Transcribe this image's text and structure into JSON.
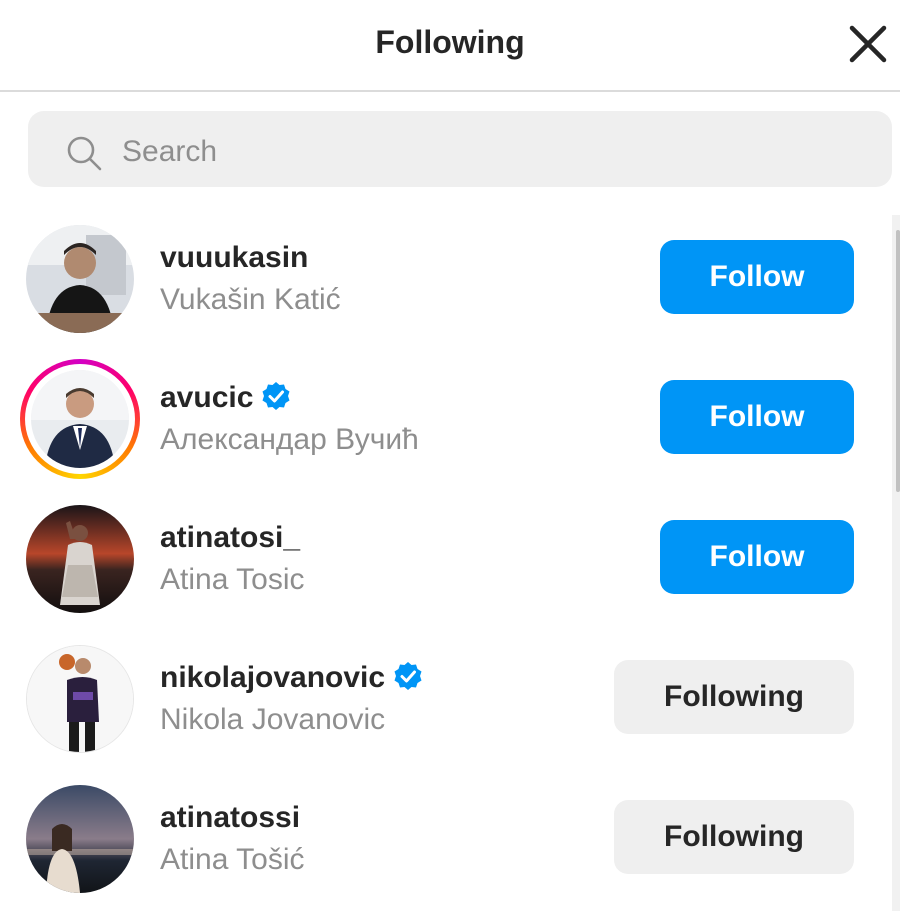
{
  "header": {
    "title": "Following",
    "close_icon": "close-icon"
  },
  "search": {
    "placeholder": "Search",
    "value": "",
    "icon": "search-icon"
  },
  "users": [
    {
      "username": "vuuukasin",
      "full_name": "Vukašin Katić",
      "verified": false,
      "story_ring": false,
      "button": "Follow",
      "button_state": "follow"
    },
    {
      "username": "avucic",
      "full_name": "Александар Вучић",
      "verified": true,
      "story_ring": true,
      "button": "Follow",
      "button_state": "follow"
    },
    {
      "username": "atinatosi_",
      "full_name": "Atina Tosic",
      "verified": false,
      "story_ring": false,
      "button": "Follow",
      "button_state": "follow"
    },
    {
      "username": "nikolajovanovic",
      "full_name": "Nikola Jovanovic",
      "verified": true,
      "story_ring": false,
      "button": "Following",
      "button_state": "following"
    },
    {
      "username": "atinatossi",
      "full_name": "Atina Tošić",
      "verified": false,
      "story_ring": false,
      "button": "Following",
      "button_state": "following"
    }
  ],
  "colors": {
    "follow_button": "#0095f6",
    "following_button": "#efefef",
    "verified_badge": "#0095f6",
    "secondary_text": "#8e8e8e"
  }
}
